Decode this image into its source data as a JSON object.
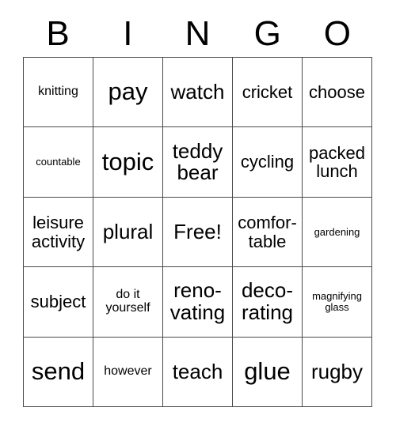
{
  "card": {
    "title": "BINGO",
    "columns": 5,
    "rows": 5,
    "free_space_label": "Free!",
    "free_space_position": [
      2,
      2
    ],
    "colors": {
      "background": "#ffffff",
      "text": "#000000",
      "grid_line": "#4a4a4a"
    }
  },
  "header": {
    "letters": [
      "B",
      "I",
      "N",
      "G",
      "O"
    ]
  },
  "grid": {
    "rows": [
      [
        {
          "text": "knitting",
          "size": "sm"
        },
        {
          "text": "pay",
          "size": "xl"
        },
        {
          "text": "watch",
          "size": "lg"
        },
        {
          "text": "cricket",
          "size": "md"
        },
        {
          "text": "choose",
          "size": "md"
        }
      ],
      [
        {
          "text": "countable",
          "size": "xs"
        },
        {
          "text": "topic",
          "size": "xl"
        },
        {
          "text": "teddy\nbear",
          "size": "lg"
        },
        {
          "text": "cycling",
          "size": "md"
        },
        {
          "text": "packed\nlunch",
          "size": "md"
        }
      ],
      [
        {
          "text": "leisure\nactivity",
          "size": "md"
        },
        {
          "text": "plural",
          "size": "lg"
        },
        {
          "text": "Free!",
          "size": "lg"
        },
        {
          "text": "comfor-\ntable",
          "size": "md"
        },
        {
          "text": "gardening",
          "size": "xs"
        }
      ],
      [
        {
          "text": "subject",
          "size": "md"
        },
        {
          "text": "do it\nyourself",
          "size": "sm"
        },
        {
          "text": "reno-\nvating",
          "size": "lg"
        },
        {
          "text": "deco-\nrating",
          "size": "lg"
        },
        {
          "text": "magnifying\nglass",
          "size": "xs"
        }
      ],
      [
        {
          "text": "send",
          "size": "xl"
        },
        {
          "text": "however",
          "size": "sm"
        },
        {
          "text": "teach",
          "size": "lg"
        },
        {
          "text": "glue",
          "size": "xl"
        },
        {
          "text": "rugby",
          "size": "lg"
        }
      ]
    ]
  }
}
